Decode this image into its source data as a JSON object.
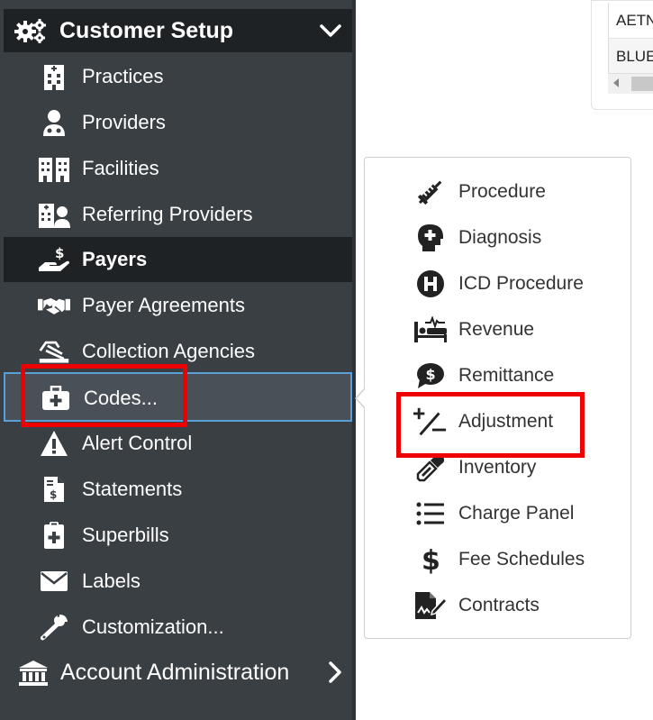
{
  "sidebar": {
    "header": {
      "title": "Customer Setup",
      "icon": "gears-icon",
      "expand_icon": "chevron-down-icon"
    },
    "items": [
      {
        "label": "Practices",
        "icon": "hospital-icon"
      },
      {
        "label": "Providers",
        "icon": "doctor-icon"
      },
      {
        "label": "Facilities",
        "icon": "buildings-icon"
      },
      {
        "label": "Referring Providers",
        "icon": "clinic-user-icon"
      },
      {
        "label": "Payers",
        "icon": "hand-dollar-icon"
      },
      {
        "label": "Payer Agreements",
        "icon": "handshake-icon"
      },
      {
        "label": "Collection Agencies",
        "icon": "signature-icon"
      },
      {
        "label": "Codes...",
        "icon": "medkit-icon"
      },
      {
        "label": "Alert Control",
        "icon": "warning-icon"
      },
      {
        "label": "Statements",
        "icon": "invoice-icon"
      },
      {
        "label": "Superbills",
        "icon": "clipboard-medical-icon"
      },
      {
        "label": "Labels",
        "icon": "envelope-icon"
      },
      {
        "label": "Customization...",
        "icon": "wrench-icon"
      }
    ],
    "account": {
      "label": "Account Administration",
      "icon": "bank-icon",
      "chevron": "chevron-right-icon"
    }
  },
  "table_fragment": {
    "rows": [
      "AETN",
      "BLUE"
    ]
  },
  "flyout": {
    "items": [
      {
        "label": "Procedure",
        "icon": "syringe-icon"
      },
      {
        "label": "Diagnosis",
        "icon": "head-medical-icon"
      },
      {
        "label": "ICD Procedure",
        "icon": "h-circle-icon"
      },
      {
        "label": "Revenue",
        "icon": "hospital-bed-icon"
      },
      {
        "label": "Remittance",
        "icon": "comment-dollar-icon"
      },
      {
        "label": "Adjustment",
        "icon": "plus-slash-minus-icon"
      },
      {
        "label": "Inventory",
        "icon": "eyedropper-icon"
      },
      {
        "label": "Charge Panel",
        "icon": "list-icon"
      },
      {
        "label": "Fee Schedules",
        "icon": "dollar-icon"
      },
      {
        "label": "Contracts",
        "icon": "file-signature-icon"
      }
    ]
  },
  "colors": {
    "sidebar_bg": "#3a3f44",
    "active_bg": "#1f2225",
    "hover_border": "#5aa0d8",
    "highlight": "#ee0000"
  }
}
